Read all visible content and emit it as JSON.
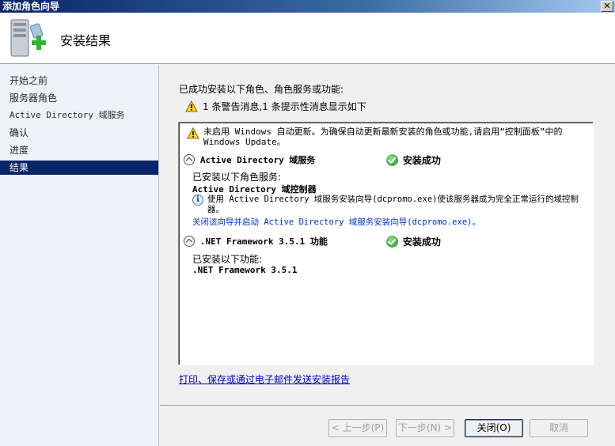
{
  "window": {
    "title": "添加角色向导",
    "close_glyph": "✕"
  },
  "header": {
    "title": "安装结果",
    "icon": "server-add-icon"
  },
  "sidebar": {
    "items": [
      {
        "label": "开始之前",
        "active": false
      },
      {
        "label": "服务器角色",
        "active": false
      },
      {
        "label": "Active Directory 域服务",
        "active": false
      },
      {
        "label": "确认",
        "active": false
      },
      {
        "label": "进度",
        "active": false
      },
      {
        "label": "结果",
        "active": true
      }
    ]
  },
  "content": {
    "success_text": "已成功安装以下角色、角色服务或功能:",
    "warning_summary": "1 条警告消息,1 条提示性消息显示如下",
    "results": {
      "update_warning": "未启用 Windows 自动更新。为确保自动更新最新安装的角色或功能,请启用“控制面板”中的 Windows Update。",
      "sections": [
        {
          "title": "Active Directory 域服务",
          "status": "安装成功",
          "installed_label": "已安装以下角色服务:",
          "item": "Active Directory 域控制器",
          "info": "使用 Active Directory 域服务安装向导(dcpromo.exe)使该服务器成为完全正常运行的域控制器。",
          "link": "关闭该向导并启动 Active Directory 域服务安装向导(dcpromo.exe)。"
        },
        {
          "title": ".NET Framework 3.5.1 功能",
          "status": "安装成功",
          "installed_label": "已安装以下功能:",
          "item": ".NET Framework 3.5.1"
        }
      ]
    },
    "report_link": "打印、保存或通过电子邮件发送安装报告"
  },
  "footer": {
    "back": "< 上一步(P)",
    "next": "下一步(N) >",
    "close": "关闭(O)",
    "cancel": "取消"
  },
  "colors": {
    "title_bar": "#0a246a",
    "nav_active": "#0a246a",
    "link": "#0000cc",
    "success": "#1c8a1c"
  }
}
